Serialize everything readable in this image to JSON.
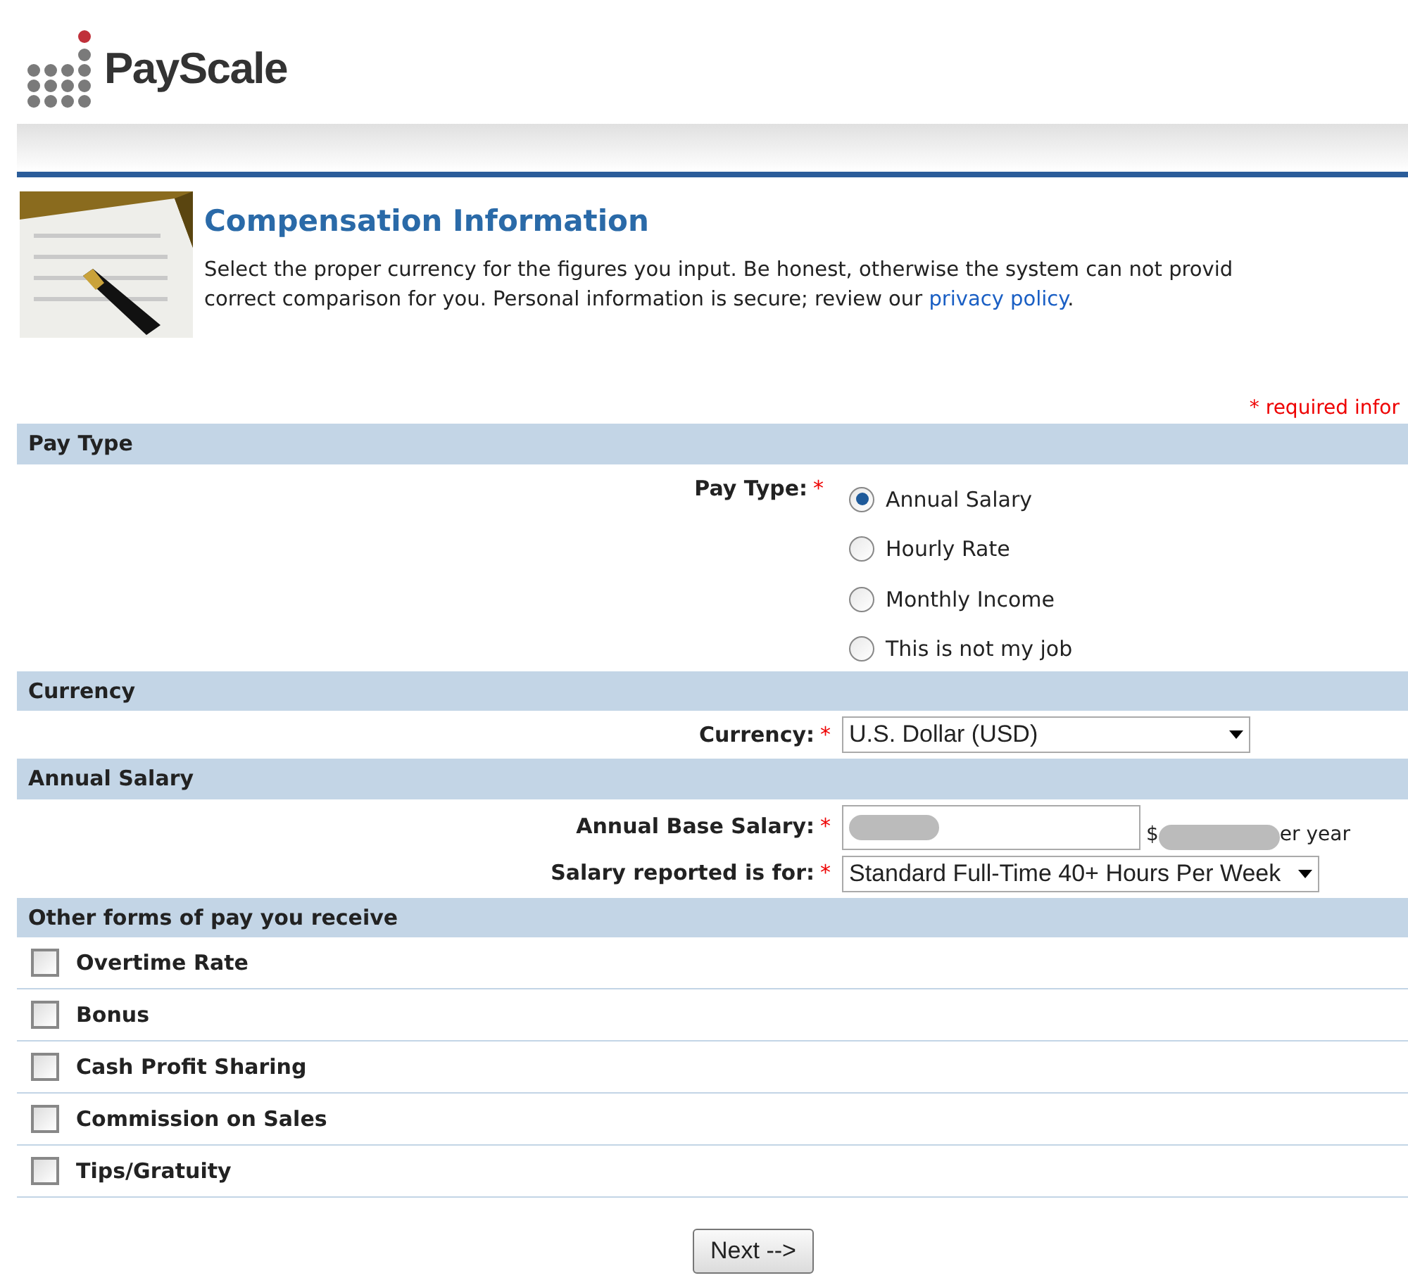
{
  "logo": {
    "name": "PayScale"
  },
  "header": {
    "title": "Compensation Information",
    "intro": "Select the proper currency for the figures you input. Be honest, otherwise the system can not provid correct comparison for you. Personal information is secure; review our ",
    "link": "privacy policy",
    "after": "."
  },
  "required_note": "* required infor",
  "sections": [
    {
      "kind": "radio",
      "title": "Pay Type",
      "label": "Pay Type:",
      "mark": "*",
      "options": [
        {
          "label": "Annual Salary",
          "selected": true
        },
        {
          "label": "Hourly Rate",
          "selected": false
        },
        {
          "label": "Monthly Income",
          "selected": false
        },
        {
          "label": "This is not my job",
          "selected": false
        }
      ]
    },
    {
      "kind": "fields",
      "title": "Currency",
      "fields": [
        {
          "kind": "select",
          "label": "Currency:",
          "mark": "*",
          "value": "U.S. Dollar (USD)"
        }
      ]
    },
    {
      "kind": "fields",
      "title": "Annual Salary",
      "fields": [
        {
          "kind": "redacted-input",
          "label": "Annual Base Salary:",
          "mark": "*",
          "prefix": "$",
          "suffix": "er year"
        },
        {
          "kind": "select",
          "label": "Salary reported is for:",
          "mark": "*",
          "value": "Standard Full-Time 40+ Hours Per Week"
        }
      ]
    },
    {
      "kind": "checks",
      "title": "Other forms of pay you receive",
      "items": [
        {
          "label": "Overtime Rate",
          "checked": false
        },
        {
          "label": "Bonus",
          "checked": false
        },
        {
          "label": "Cash Profit Sharing",
          "checked": false
        },
        {
          "label": "Commission on Sales",
          "checked": false
        },
        {
          "label": "Tips/Gratuity",
          "checked": false
        }
      ]
    }
  ],
  "button": "Next -->"
}
